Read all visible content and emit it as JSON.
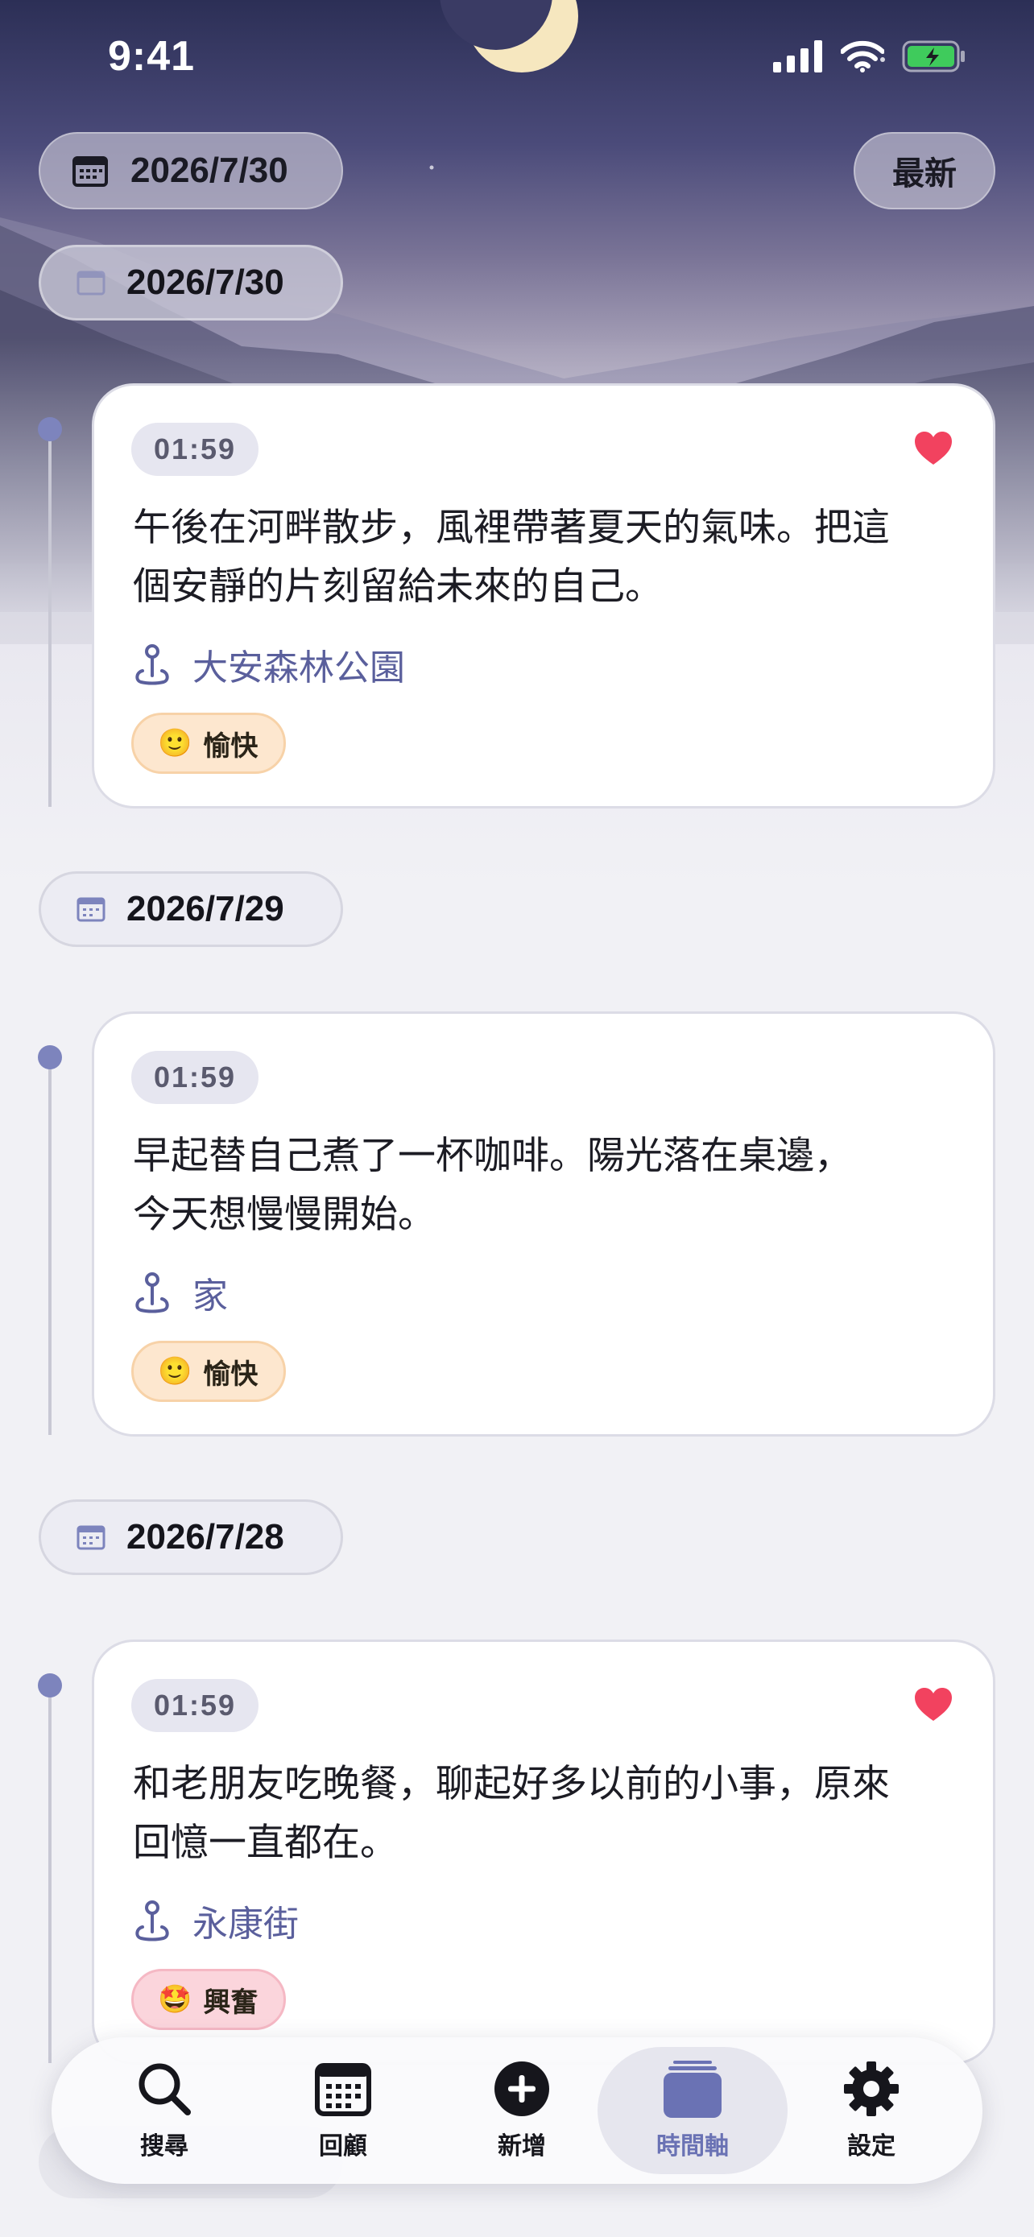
{
  "status_bar": {
    "time": "9:41",
    "icons": [
      "cellular-signal-icon",
      "wifi-icon",
      "battery-charging-icon"
    ]
  },
  "header": {
    "current_date": "2026/7/30",
    "latest_button": "最新"
  },
  "timeline": {
    "groups": [
      {
        "date": "2026/7/30",
        "entries": [
          {
            "time": "01:59",
            "favorited": true,
            "text": "午後在河畔散步，風裡帶著夏天的氣味。把這\n個安靜的片刻留給未來的自己。",
            "location": "大安森林公園",
            "mood": {
              "emoji": "🙂",
              "label": "愉快",
              "tone": "happy"
            }
          }
        ]
      },
      {
        "date": "2026/7/29",
        "entries": [
          {
            "time": "01:59",
            "favorited": false,
            "text": "早起替自己煮了一杯咖啡。陽光落在桌邊，\n今天想慢慢開始。",
            "location": "家",
            "mood": {
              "emoji": "🙂",
              "label": "愉快",
              "tone": "happy"
            }
          }
        ]
      },
      {
        "date": "2026/7/28",
        "entries": [
          {
            "time": "01:59",
            "favorited": true,
            "text": "和老朋友吃晚餐，聊起好多以前的小事，原來\n回憶一直都在。",
            "location": "永康街",
            "mood": {
              "emoji": "🤩",
              "label": "興奮",
              "tone": "excited"
            }
          }
        ]
      }
    ]
  },
  "tabbar": {
    "tabs": [
      {
        "label": "搜尋",
        "icon": "search-icon",
        "active": false
      },
      {
        "label": "回顧",
        "icon": "calendar-icon",
        "active": false
      },
      {
        "label": "新增",
        "icon": "add-circle-icon",
        "active": false
      },
      {
        "label": "時間軸",
        "icon": "timeline-stack-icon",
        "active": true
      },
      {
        "label": "設定",
        "icon": "gear-icon",
        "active": false
      }
    ]
  },
  "colors": {
    "accent": "#6a72b4",
    "heart": "#f2425f",
    "location_text": "#5a5f9c",
    "timeline_dot": "#7d84bd"
  }
}
